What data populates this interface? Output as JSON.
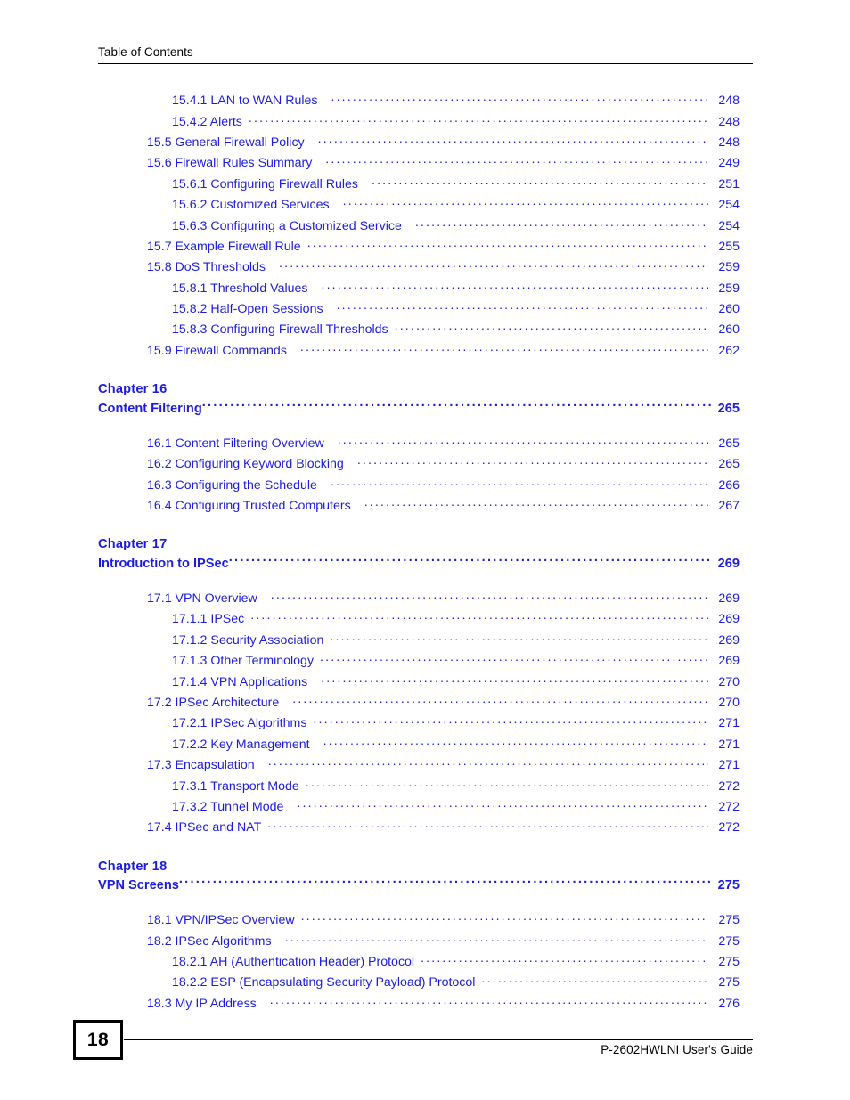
{
  "header": {
    "title": "Table of Contents"
  },
  "footer": {
    "page_number": "18",
    "guide_title": "P-2602HWLNI User's Guide"
  },
  "colors": {
    "link_blue": "#1c1ce0",
    "text_black": "#000000",
    "page_background": "#ffffff"
  },
  "toc": {
    "groups": [
      {
        "chapter": null,
        "entries": [
          {
            "label": "15.4.1 LAN to WAN Rules",
            "page": "248",
            "level": 3,
            "gap": true
          },
          {
            "label": "15.4.2 Alerts",
            "page": "248",
            "level": 3,
            "gap": false
          },
          {
            "label": "15.5 General Firewall Policy",
            "page": "248",
            "level": 2,
            "gap": true
          },
          {
            "label": "15.6 Firewall Rules Summary",
            "page": "249",
            "level": 2,
            "gap": true
          },
          {
            "label": "15.6.1 Configuring Firewall Rules",
            "page": "251",
            "level": 3,
            "gap": true
          },
          {
            "label": "15.6.2 Customized Services",
            "page": "254",
            "level": 3,
            "gap": true
          },
          {
            "label": "15.6.3 Configuring a Customized Service",
            "page": "254",
            "level": 3,
            "gap": true
          },
          {
            "label": "15.7 Example Firewall Rule",
            "page": "255",
            "level": 2,
            "gap": false
          },
          {
            "label": "15.8 DoS Thresholds",
            "page": "259",
            "level": 2,
            "gap": true
          },
          {
            "label": "15.8.1 Threshold Values",
            "page": "259",
            "level": 3,
            "gap": true
          },
          {
            "label": "15.8.2 Half-Open Sessions",
            "page": "260",
            "level": 3,
            "gap": true
          },
          {
            "label": "15.8.3 Configuring Firewall Thresholds",
            "page": "260",
            "level": 3,
            "gap": false
          },
          {
            "label": "15.9 Firewall Commands",
            "page": "262",
            "level": 2,
            "gap": true
          }
        ]
      },
      {
        "chapter": {
          "number_line": "Chapter  16",
          "title": "Content Filtering",
          "page": "265"
        },
        "entries": [
          {
            "label": "16.1 Content Filtering Overview",
            "page": "265",
            "level": 2,
            "gap": true
          },
          {
            "label": "16.2 Configuring Keyword Blocking",
            "page": "265",
            "level": 2,
            "gap": true
          },
          {
            "label": "16.3 Configuring the Schedule",
            "page": "266",
            "level": 2,
            "gap": true
          },
          {
            "label": "16.4 Configuring Trusted Computers",
            "page": "267",
            "level": 2,
            "gap": true
          }
        ]
      },
      {
        "chapter": {
          "number_line": "Chapter  17",
          "title": "Introduction to IPSec",
          "page": "269"
        },
        "entries": [
          {
            "label": "17.1 VPN Overview",
            "page": "269",
            "level": 2,
            "gap": true
          },
          {
            "label": "17.1.1 IPSec",
            "page": "269",
            "level": 3,
            "gap": false
          },
          {
            "label": "17.1.2 Security Association",
            "page": "269",
            "level": 3,
            "gap": false
          },
          {
            "label": "17.1.3 Other Terminology",
            "page": "269",
            "level": 3,
            "gap": false
          },
          {
            "label": "17.1.4 VPN Applications",
            "page": "270",
            "level": 3,
            "gap": true
          },
          {
            "label": "17.2 IPSec Architecture",
            "page": "270",
            "level": 2,
            "gap": true
          },
          {
            "label": "17.2.1 IPSec Algorithms",
            "page": "271",
            "level": 3,
            "gap": false
          },
          {
            "label": "17.2.2 Key Management",
            "page": "271",
            "level": 3,
            "gap": true
          },
          {
            "label": "17.3 Encapsulation",
            "page": "271",
            "level": 2,
            "gap": true
          },
          {
            "label": "17.3.1 Transport Mode",
            "page": "272",
            "level": 3,
            "gap": false
          },
          {
            "label": "17.3.2 Tunnel Mode",
            "page": "272",
            "level": 3,
            "gap": true
          },
          {
            "label": "17.4 IPSec and NAT",
            "page": "272",
            "level": 2,
            "gap": false
          }
        ]
      },
      {
        "chapter": {
          "number_line": "Chapter  18",
          "title": "VPN Screens",
          "page": "275"
        },
        "entries": [
          {
            "label": "18.1 VPN/IPSec Overview",
            "page": "275",
            "level": 2,
            "gap": false
          },
          {
            "label": "18.2 IPSec Algorithms",
            "page": "275",
            "level": 2,
            "gap": true
          },
          {
            "label": "18.2.1 AH (Authentication Header) Protocol",
            "page": "275",
            "level": 3,
            "gap": false
          },
          {
            "label": "18.2.2 ESP (Encapsulating Security Payload) Protocol",
            "page": "275",
            "level": 3,
            "gap": false
          },
          {
            "label": "18.3 My IP Address",
            "page": "276",
            "level": 2,
            "gap": true
          }
        ]
      }
    ]
  }
}
